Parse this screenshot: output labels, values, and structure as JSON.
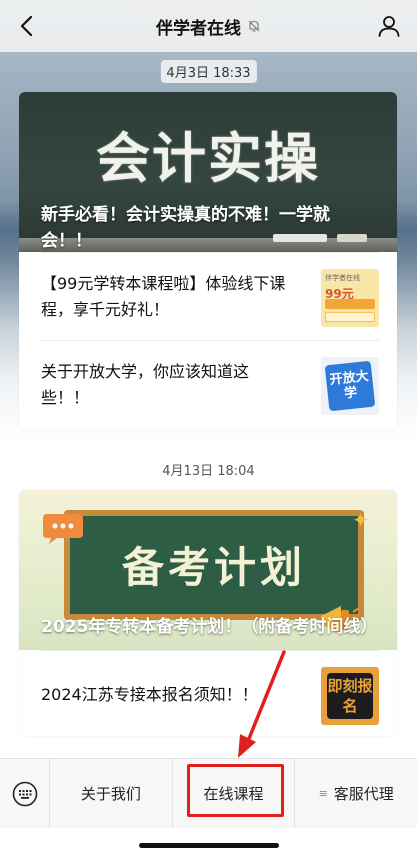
{
  "header": {
    "title": "伴学者在线"
  },
  "messages": [
    {
      "timestamp": "4月3日 18:33",
      "cover": {
        "title_art": "会计实操",
        "caption": "新手必看！会计实操真的不难！一学就会！！"
      },
      "items": [
        {
          "text": "【99元学转本课程啦】体验线下课程，享千元好礼！",
          "thumb": {
            "small": "伴学者在线",
            "headline": "99元"
          }
        },
        {
          "text": "关于开放大学，你应该知道这些！！",
          "thumb": {
            "label": "开放大学"
          }
        }
      ]
    },
    {
      "timestamp": "4月13日 18:04",
      "cover": {
        "title_art": "备考计划",
        "caption": "2025年专转本备考计划！（附备考时间线）"
      },
      "items": [
        {
          "text": "2024江苏专接本报名须知！！",
          "thumb": {
            "label": "即刻报名"
          }
        }
      ]
    }
  ],
  "bottom_menu": {
    "items": [
      "关于我们",
      "在线课程",
      "客服代理"
    ],
    "sub_menu_marker": "≡"
  },
  "icons": {
    "back": "chevron-left-icon",
    "mute": "bell-slash-icon",
    "profile": "person-icon",
    "keyboard": "keyboard-icon"
  },
  "colors": {
    "highlight": "#e0201c",
    "chalkboard": "#2c3b36"
  }
}
